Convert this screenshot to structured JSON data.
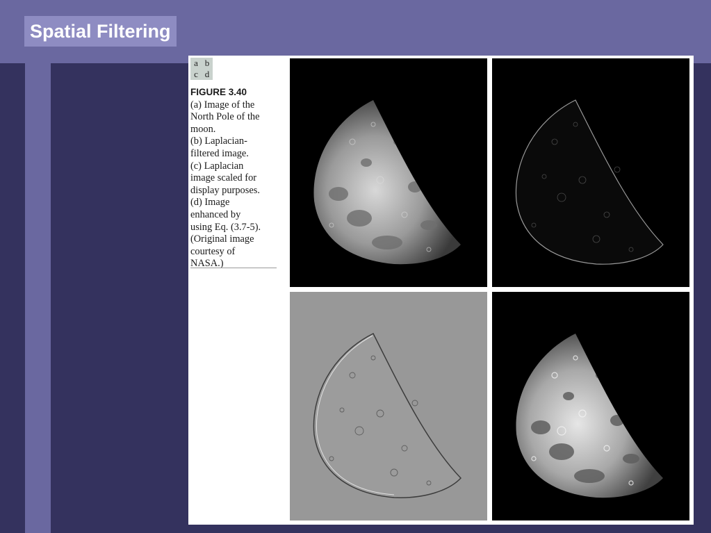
{
  "slide": {
    "title": "Spatial Filtering"
  },
  "figure": {
    "panel_key": [
      "a",
      "b",
      "c",
      "d"
    ],
    "label": "FIGURE 3.40",
    "caption_lines": [
      "(a) Image of the",
      "North Pole of the",
      "moon.",
      "(b) Laplacian-",
      "filtered image.",
      "(c) Laplacian",
      "image scaled for",
      "display purposes.",
      "(d) Image",
      "enhanced by",
      "using Eq. (3.7-5).",
      "(Original image",
      "courtesy of",
      "NASA.)"
    ],
    "panels": [
      {
        "id": "a",
        "desc_icon": "moon-original-image"
      },
      {
        "id": "b",
        "desc_icon": "moon-laplacian-image"
      },
      {
        "id": "c",
        "desc_icon": "moon-laplacian-scaled-image"
      },
      {
        "id": "d",
        "desc_icon": "moon-enhanced-image"
      }
    ]
  },
  "colors": {
    "background": "#34325e",
    "header": "#6a68a0",
    "title_box": "#8e8cc2",
    "scaled_gray": "#989898"
  }
}
